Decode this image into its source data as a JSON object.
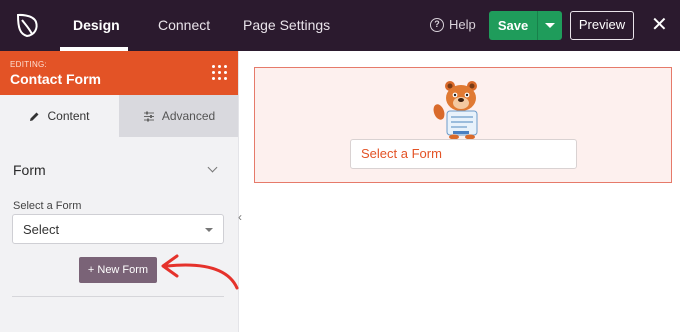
{
  "topbar": {
    "tabs": [
      "Design",
      "Connect",
      "Page Settings"
    ],
    "help_label": "Help",
    "save_label": "Save",
    "preview_label": "Preview",
    "close_symbol": "✕"
  },
  "sidebar": {
    "editing_label": "EDITING:",
    "editing_title": "Contact Form",
    "tab_content": "Content",
    "tab_advanced": "Advanced",
    "section_title": "Form",
    "field_label": "Select a Form",
    "select_value": "Select",
    "new_form_label": "+ New Form"
  },
  "canvas": {
    "form_select_placeholder": "Select a Form"
  },
  "colors": {
    "topbar": "#2b1a2e",
    "accent": "#e35326",
    "save": "#1f9c5b",
    "new_form": "#7a6377",
    "annotation_arrow": "#e5322b"
  }
}
